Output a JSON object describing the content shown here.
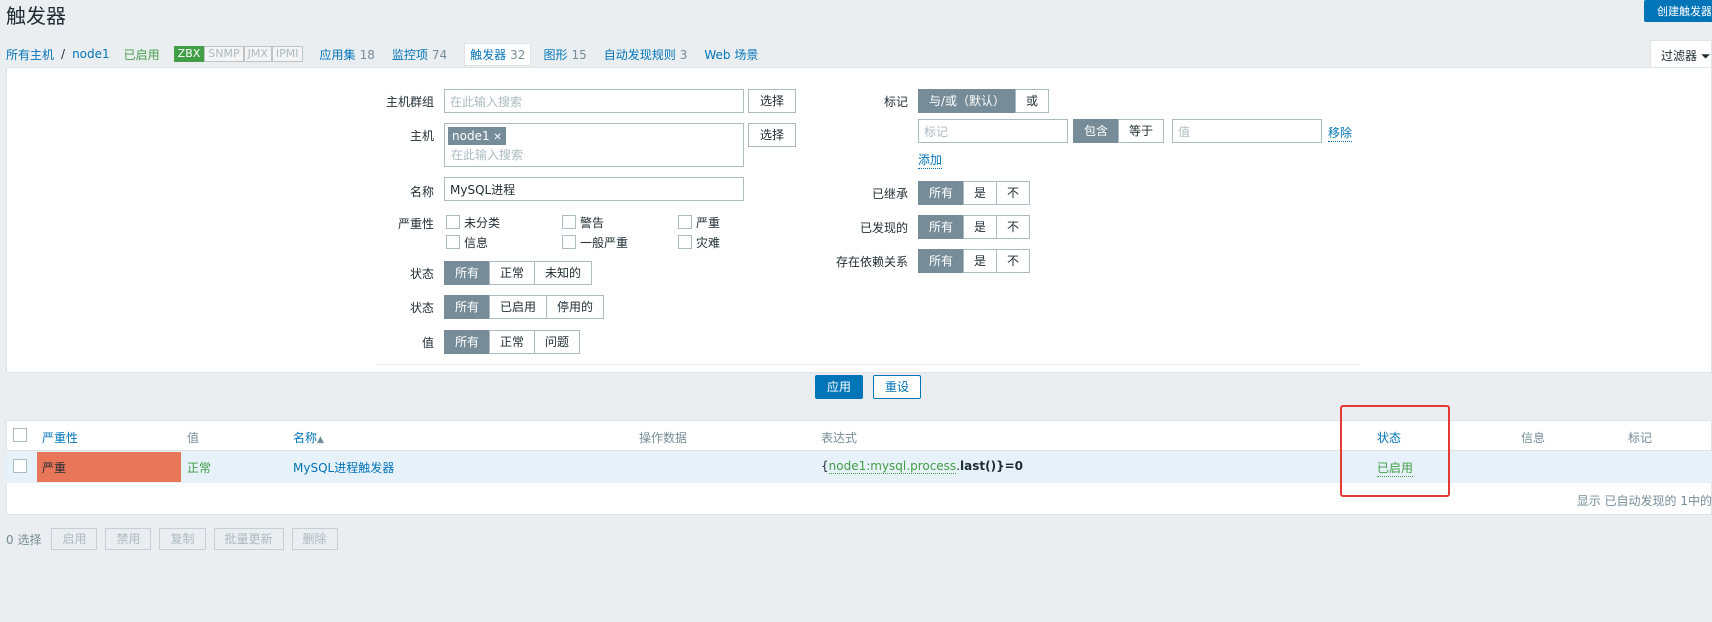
{
  "page": {
    "title": "触发器",
    "create_button": "创建触发器"
  },
  "nav": {
    "all_hosts": "所有主机",
    "separator": "/",
    "host": "node1",
    "enabled": "已启用",
    "badges": [
      "ZBX",
      "SNMP",
      "JMX",
      "IPMI"
    ],
    "items": [
      {
        "label": "应用集",
        "count": "18"
      },
      {
        "label": "监控项",
        "count": "74"
      },
      {
        "label": "触发器",
        "count": "32"
      },
      {
        "label": "图形",
        "count": "15"
      },
      {
        "label": "自动发现规则",
        "count": "3"
      },
      {
        "label": "Web 场景",
        "count": ""
      }
    ]
  },
  "filter": {
    "tab_label": "过滤器",
    "host_group_label": "主机群组",
    "host_group_placeholder": "在此输入搜索",
    "select_label": "选择",
    "host_label": "主机",
    "host_chip": "node1",
    "chip_remove": "✕",
    "host_placeholder": "在此输入搜索",
    "name_label": "名称",
    "name_value": "MySQL进程",
    "severity_label": "严重性",
    "severities": [
      "未分类",
      "警告",
      "严重",
      "信息",
      "一般严重",
      "灾难"
    ],
    "state_label": "状态",
    "state_options": [
      "所有",
      "正常",
      "未知的"
    ],
    "status_label": "状态",
    "status_options": [
      "所有",
      "已启用",
      "停用的"
    ],
    "value_label": "值",
    "value_options": [
      "所有",
      "正常",
      "问题"
    ],
    "tags_label": "标记",
    "tags_eval_options": [
      "与/或（默认）",
      "或"
    ],
    "tag_placeholder": "标记",
    "tag_op_options": [
      "包含",
      "等于"
    ],
    "tag_value_placeholder": "值",
    "remove": "移除",
    "add": "添加",
    "inherited_label": "已继承",
    "discovered_label": "已发现的",
    "dependencies_label": "存在依赖关系",
    "tri_options": [
      "所有",
      "是",
      "不"
    ],
    "apply": "应用",
    "reset": "重设"
  },
  "table": {
    "headers": {
      "severity": "严重性",
      "value": "值",
      "name": "名称",
      "sort_arrow": "▲",
      "operational_data": "操作数据",
      "expression": "表达式",
      "status": "状态",
      "info": "信息",
      "tags": "标记"
    },
    "rows": [
      {
        "severity": "严重",
        "value": "正常",
        "name": "MySQL进程触发器",
        "expression": {
          "open": "{",
          "item": "node1:mysql.process",
          "dot": ".",
          "func": "last",
          "close": "()}=0"
        },
        "status": "已启用"
      }
    ],
    "footer": "显示 已自动发现的 1中的"
  },
  "actions": {
    "selected": "0 选择",
    "buttons": [
      "启用",
      "禁用",
      "复制",
      "批量更新",
      "删除"
    ]
  },
  "colors": {
    "accent": "#0275b8",
    "severity_high": "#e97659",
    "ok_green": "#429e47",
    "annotation": "#e53935"
  }
}
